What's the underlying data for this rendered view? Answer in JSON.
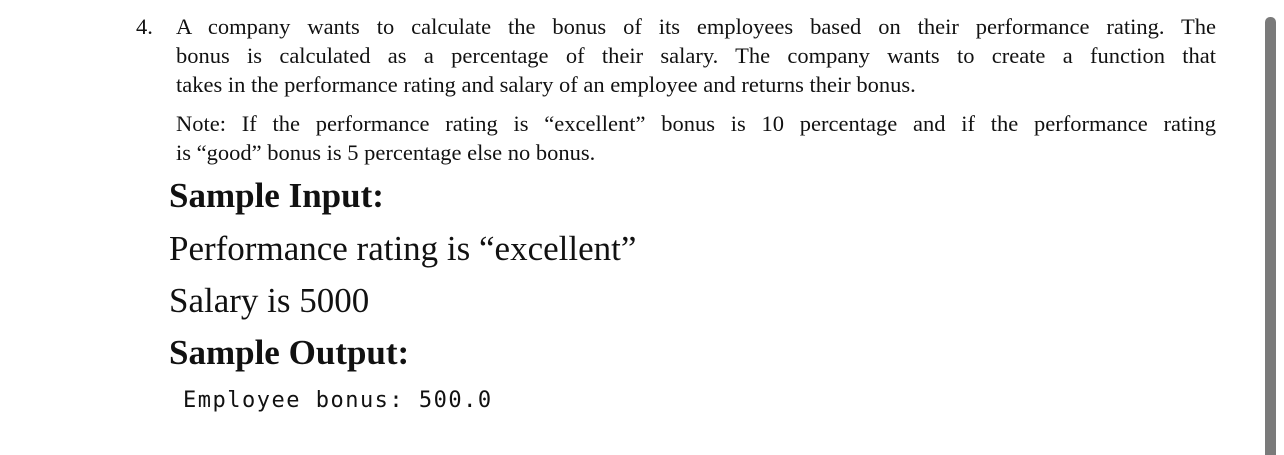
{
  "question": {
    "number": "4.",
    "lines": [
      "A company wants to calculate the bonus of its employees based on their performance rating. The",
      "bonus is calculated as a percentage of their salary. The company wants to create a function that",
      "takes in the performance rating and salary of an employee and returns their bonus."
    ],
    "note_lines": [
      "Note: If the performance rating is “excellent” bonus is 10 percentage and if the performance rating",
      "is “good” bonus is 5 percentage else no bonus."
    ]
  },
  "sample_input": {
    "heading": "Sample Input:",
    "lines": [
      "Performance rating is “excellent”",
      "Salary is 5000"
    ]
  },
  "sample_output": {
    "heading": "Sample Output:",
    "text": "Employee bonus: 500.0"
  }
}
